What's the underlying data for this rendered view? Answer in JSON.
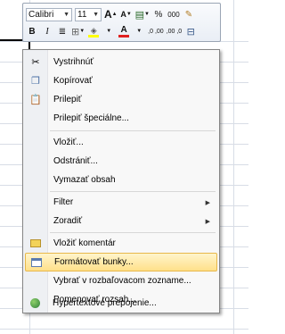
{
  "toolbar": {
    "font_name": "Calibri",
    "font_size": "11",
    "grow_font": "A",
    "shrink_font": "A",
    "currency_icon": "accounting-format-icon",
    "percent": "%",
    "thousands": "000",
    "format_painter_icon": "format-painter-icon",
    "bold": "B",
    "italic": "I",
    "align_icon": "center-align-icon",
    "borders_icon": "borders-icon",
    "fill_icon": "fill-color-icon",
    "font_color": "A",
    "increase_decimal": ",0 ,00",
    "decrease_decimal": ",00 ,0",
    "merge_icon": "merge-cells-icon"
  },
  "menu": {
    "items": [
      {
        "label": "Vystrihnúť",
        "icon": "cut-icon"
      },
      {
        "label": "Kopírovať",
        "icon": "copy-icon"
      },
      {
        "label": "Prilepiť",
        "icon": "paste-icon"
      },
      {
        "label": "Prilepiť špeciálne..."
      },
      {
        "label": "Vložiť..."
      },
      {
        "label": "Odstrániť..."
      },
      {
        "label": "Vymazať obsah"
      },
      {
        "label": "Filter",
        "submenu": true
      },
      {
        "label": "Zoradiť",
        "submenu": true
      },
      {
        "label": "Vložiť komentár",
        "icon": "comment-icon"
      },
      {
        "label": "Formátovať bunky...",
        "icon": "format-cells-icon",
        "highlighted": true
      },
      {
        "label": "Vybrať v rozbaľovacom zozname..."
      },
      {
        "label": "Pomenovať rozsah..."
      },
      {
        "label": "Hypertextové prepojenie...",
        "icon": "hyperlink-icon"
      }
    ]
  },
  "colors": {
    "highlight": "#ffe08a",
    "fill_swatch": "#ffff00",
    "font_color_swatch": "#e02020"
  }
}
